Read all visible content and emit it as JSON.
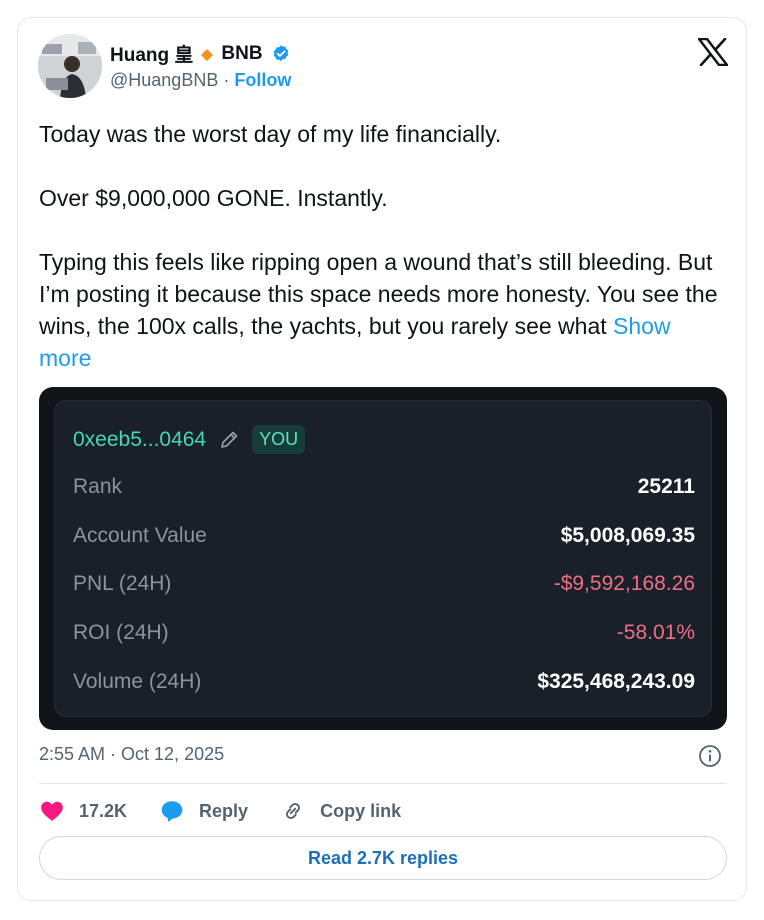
{
  "author": {
    "name": "Huang 皇",
    "badge_label": "BNB",
    "handle": "@HuangBNB",
    "separator": "·",
    "follow_label": "Follow"
  },
  "tweet": {
    "paragraphs": [
      "Today was the worst day of my life financially.",
      "Over $9,000,000 GONE. Instantly.",
      "Typing this feels like ripping open a wound that’s still bleeding. But I’m posting it because this space needs more honesty. You see the wins, the 100x calls, the yachts, but you rarely see what"
    ],
    "show_more_label": "Show more",
    "timestamp": "2:55 AM · Oct 12, 2025"
  },
  "media": {
    "address": "0xeeb5...0464",
    "you_badge": "YOU",
    "stats": [
      {
        "label": "Rank",
        "value": "25211",
        "negative": false
      },
      {
        "label": "Account Value",
        "value": "$5,008,069.35",
        "negative": false
      },
      {
        "label": "PNL (24H)",
        "value": "-$9,592,168.26",
        "negative": true
      },
      {
        "label": "ROI (24H)",
        "value": "-58.01%",
        "negative": true
      },
      {
        "label": "Volume (24H)",
        "value": "$325,468,243.09",
        "negative": false
      }
    ]
  },
  "actions": {
    "likes": "17.2K",
    "reply_label": "Reply",
    "copy_link_label": "Copy link",
    "read_replies_label": "Read 2.7K replies"
  },
  "colors": {
    "accent": "#1d9bf0",
    "like": "#f91880",
    "teal": "#47d6b8",
    "negative": "#ed6f84"
  },
  "icons": [
    "avatar",
    "diamond-icon",
    "verified-icon",
    "x-logo-icon",
    "pencil-icon",
    "info-icon",
    "heart-icon",
    "reply-icon",
    "link-icon"
  ]
}
